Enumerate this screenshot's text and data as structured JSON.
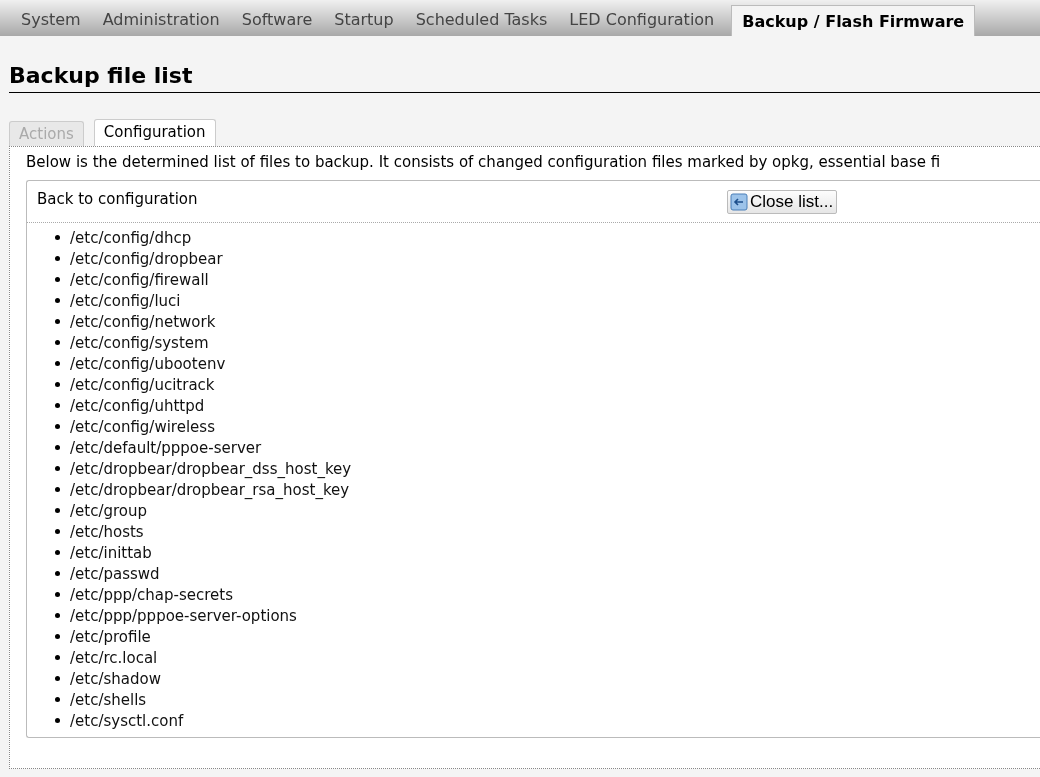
{
  "tabs": [
    {
      "label": "System",
      "selected": false
    },
    {
      "label": "Administration",
      "selected": false
    },
    {
      "label": "Software",
      "selected": false
    },
    {
      "label": "Startup",
      "selected": false
    },
    {
      "label": "Scheduled Tasks",
      "selected": false
    },
    {
      "label": "LED Configuration",
      "selected": false
    },
    {
      "label": "Backup / Flash Firmware",
      "selected": true
    }
  ],
  "heading": "Backup file list",
  "subtabs": [
    {
      "label": "Actions",
      "selected": false,
      "disabled": true
    },
    {
      "label": "Configuration",
      "selected": true,
      "disabled": false
    }
  ],
  "description": "Below is the determined list of files to backup. It consists of changed configuration files marked by opkg, essential base fi",
  "section": {
    "title": "Back to configuration",
    "button": "Close list..."
  },
  "files": [
    "/etc/config/dhcp",
    "/etc/config/dropbear",
    "/etc/config/firewall",
    "/etc/config/luci",
    "/etc/config/network",
    "/etc/config/system",
    "/etc/config/ubootenv",
    "/etc/config/ucitrack",
    "/etc/config/uhttpd",
    "/etc/config/wireless",
    "/etc/default/pppoe-server",
    "/etc/dropbear/dropbear_dss_host_key",
    "/etc/dropbear/dropbear_rsa_host_key",
    "/etc/group",
    "/etc/hosts",
    "/etc/inittab",
    "/etc/passwd",
    "/etc/ppp/chap-secrets",
    "/etc/ppp/pppoe-server-options",
    "/etc/profile",
    "/etc/rc.local",
    "/etc/shadow",
    "/etc/shells",
    "/etc/sysctl.conf"
  ]
}
